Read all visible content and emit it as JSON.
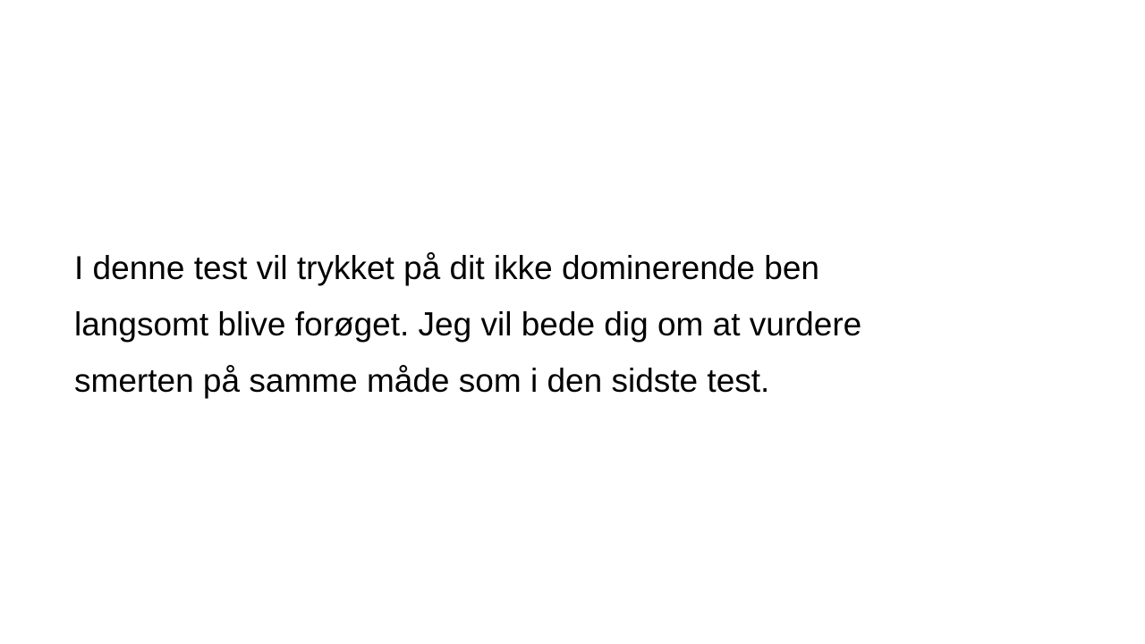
{
  "slide": {
    "body_lines": [
      "I denne test vil trykket på dit ikke dominerende ben",
      "langsomt blive forøget. Jeg vil bede dig om at vurdere",
      "smerten på samme måde som i den sidste test."
    ]
  }
}
